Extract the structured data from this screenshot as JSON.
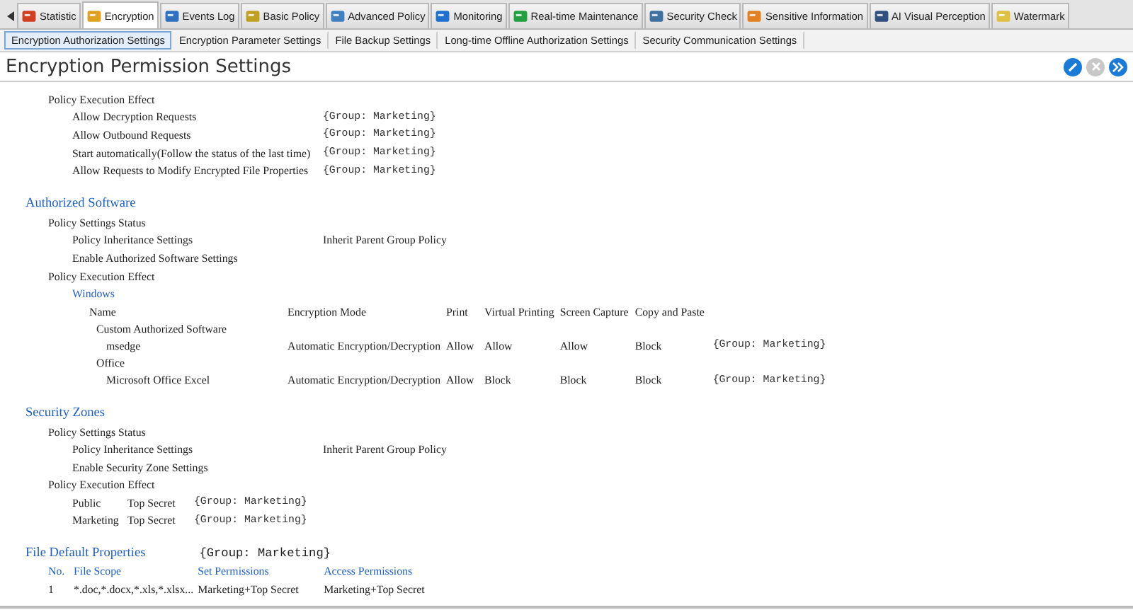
{
  "tabs": [
    {
      "label": "Statistic",
      "selected": false
    },
    {
      "label": "Encryption",
      "selected": true
    },
    {
      "label": "Events Log",
      "selected": false
    },
    {
      "label": "Basic Policy",
      "selected": false
    },
    {
      "label": "Advanced Policy",
      "selected": false
    },
    {
      "label": "Monitoring",
      "selected": false
    },
    {
      "label": "Real-time Maintenance",
      "selected": false
    },
    {
      "label": "Security Check",
      "selected": false
    },
    {
      "label": "Sensitive Information",
      "selected": false
    },
    {
      "label": "AI Visual Perception",
      "selected": false
    },
    {
      "label": "Watermark",
      "selected": false
    }
  ],
  "subtabs": [
    {
      "label": "Encryption Authorization Settings",
      "selected": true
    },
    {
      "label": "Encryption Parameter Settings",
      "selected": false
    },
    {
      "label": "File Backup Settings",
      "selected": false
    },
    {
      "label": "Long-time Offline Authorization Settings",
      "selected": false
    },
    {
      "label": "Security Communication Settings",
      "selected": false
    }
  ],
  "title": "Encryption Permission Settings",
  "toolbar": [
    {
      "kind": "edit",
      "disabled": false
    },
    {
      "kind": "delete",
      "disabled": true
    },
    {
      "kind": "forward",
      "disabled": false
    }
  ],
  "sections": [
    {
      "items": [
        {
          "label": "Policy Execution Effect",
          "children": [
            {
              "kind": "setting",
              "label": "Allow Decryption Requests",
              "value": "{Group: Marketing}"
            },
            {
              "kind": "setting",
              "label": "Allow Outbound Requests",
              "value": "{Group: Marketing}"
            },
            {
              "kind": "setting",
              "label": "Start automatically(Follow the status of the last time)",
              "value": "{Group: Marketing}"
            },
            {
              "kind": "setting",
              "label": "Allow Requests to Modify Encrypted File Properties",
              "value": "{Group: Marketing}"
            }
          ]
        }
      ]
    },
    {
      "heading": "Authorized Software",
      "items": [
        {
          "label": "Policy Settings Status",
          "children": [
            {
              "kind": "setting",
              "label": "Policy Inheritance Settings",
              "note": "Inherit Parent Group Policy"
            },
            {
              "kind": "setting",
              "label": "Enable Authorized Software Settings"
            }
          ]
        },
        {
          "label": "Policy Execution Effect",
          "children": [
            {
              "kind": "software_table",
              "label": "Windows",
              "columns": [
                "Name",
                "Encryption Mode",
                "Print",
                "Virtual Printing",
                "Screen Capture",
                "Copy and Paste"
              ],
              "rows": [
                {
                  "name": "Custom Authorized Software",
                  "children": [
                    {
                      "name": "msedge",
                      "cells": [
                        "Automatic Encryption/Decryption",
                        "Allow",
                        "Allow",
                        "Allow",
                        "Block",
                        "{Group: Marketing}"
                      ]
                    }
                  ]
                },
                {
                  "name": "Office",
                  "children": [
                    {
                      "name": "Microsoft Office Excel",
                      "cells": [
                        "Automatic Encryption/Decryption",
                        "Allow",
                        "Block",
                        "Block",
                        "Block",
                        "{Group: Marketing}"
                      ]
                    }
                  ]
                }
              ]
            }
          ]
        }
      ]
    },
    {
      "heading": "Security Zones",
      "items": [
        {
          "label": "Policy Settings Status",
          "children": [
            {
              "kind": "setting",
              "label": "Policy Inheritance Settings",
              "note": "Inherit Parent Group Policy"
            },
            {
              "kind": "setting",
              "label": "Enable Security Zone Settings"
            }
          ]
        },
        {
          "label": "Policy Execution Effect",
          "children": [
            {
              "kind": "zone",
              "cells": [
                "Public",
                "Top Secret",
                "{Group: Marketing}"
              ]
            },
            {
              "kind": "zone",
              "cells": [
                "Marketing",
                "Top Secret",
                "{Group: Marketing}"
              ]
            }
          ]
        }
      ]
    },
    {
      "heading": "File Default Properties",
      "group": "{Group: Marketing}",
      "table": {
        "columns": [
          "No.",
          "File Scope",
          "Set Permissions",
          "Access Permissions"
        ],
        "rows": [
          [
            "1",
            "*.doc,*.docx,*.xls,*.xlsx...",
            "Marketing+Top Secret",
            "Marketing+Top Secret"
          ]
        ]
      }
    }
  ]
}
